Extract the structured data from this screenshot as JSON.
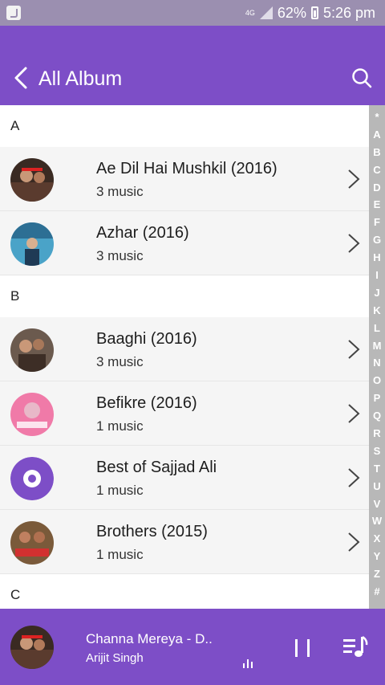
{
  "status": {
    "network": "4G",
    "battery": "62%",
    "time": "5:26 pm"
  },
  "header": {
    "title": "All Album"
  },
  "sections": [
    {
      "letter": "A",
      "items": [
        {
          "name": "Ae Dil Hai Mushkil (2016)",
          "count": "3 music"
        },
        {
          "name": "Azhar (2016)",
          "count": "3 music"
        }
      ]
    },
    {
      "letter": "B",
      "items": [
        {
          "name": "Baaghi (2016)",
          "count": "3 music"
        },
        {
          "name": "Befikre (2016)",
          "count": "1 music"
        },
        {
          "name": "Best of Sajjad Ali",
          "count": "1 music"
        },
        {
          "name": "Brothers (2015)",
          "count": "1 music"
        }
      ]
    },
    {
      "letter": "C",
      "items": []
    }
  ],
  "alphabet": [
    "*",
    "A",
    "B",
    "C",
    "D",
    "E",
    "F",
    "G",
    "H",
    "I",
    "J",
    "K",
    "L",
    "M",
    "N",
    "O",
    "P",
    "Q",
    "R",
    "S",
    "T",
    "U",
    "V",
    "W",
    "X",
    "Y",
    "Z",
    "#"
  ],
  "player": {
    "song": "Channa Mereya -  D..",
    "artist": "Arijit Singh"
  },
  "colors": {
    "accent": "#7d4ec7",
    "statusbar": "#9b8fb0"
  }
}
